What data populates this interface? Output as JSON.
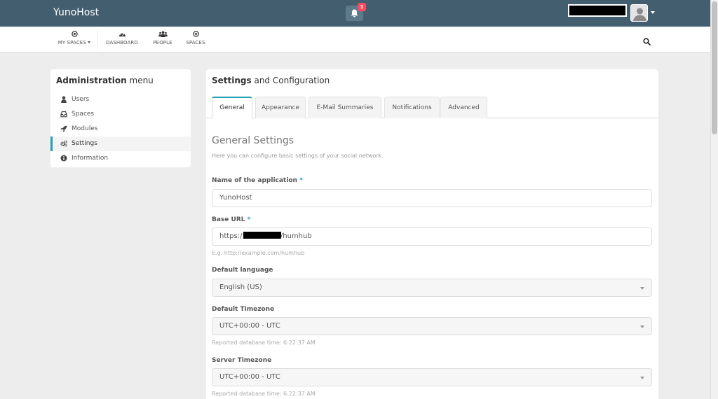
{
  "topbar": {
    "brand": "YunoHost",
    "notification_count": "1",
    "colors": {
      "bar": "#435f6f",
      "accent": "#21a1b3",
      "badge": "#fc4a64"
    }
  },
  "subnav": {
    "items": [
      {
        "label": "MY SPACES",
        "icon": "dot-circle-icon",
        "has_caret": true
      },
      {
        "label": "DASHBOARD",
        "icon": "tachometer-icon"
      },
      {
        "label": "PEOPLE",
        "icon": "users-icon"
      },
      {
        "label": "SPACES",
        "icon": "dot-circle-icon"
      }
    ],
    "search_icon": "search-icon"
  },
  "admin_menu": {
    "title_bold": "Administration",
    "title_rest": " menu",
    "items": [
      {
        "label": "Users",
        "icon": "user-icon"
      },
      {
        "label": "Spaces",
        "icon": "inbox-icon"
      },
      {
        "label": "Modules",
        "icon": "rocket-icon"
      },
      {
        "label": "Settings",
        "icon": "cogs-icon",
        "active": true
      },
      {
        "label": "Information",
        "icon": "info-circle-icon"
      }
    ]
  },
  "settings": {
    "title_bold": "Settings",
    "title_rest": " and Configuration",
    "tabs": [
      "General",
      "Appearance",
      "E-Mail Summaries",
      "Notifications",
      "Advanced"
    ],
    "active_tab": "General",
    "section_title": "General Settings",
    "section_desc": "Here you can configure basic settings of your social network.",
    "fields": {
      "app_name": {
        "label": "Name of the application",
        "required": "*",
        "value": "YunoHost"
      },
      "base_url": {
        "label": "Base URL",
        "required": "*",
        "value_prefix": "https://",
        "value_suffix": "/humhub",
        "hint": "E.g. http://example.com/humhub"
      },
      "default_language": {
        "label": "Default language",
        "value": "English (US)"
      },
      "default_timezone": {
        "label": "Default Timezone",
        "value": "UTC+00:00 - UTC",
        "hint": "Reported database time: 6:22:37 AM"
      },
      "server_timezone": {
        "label": "Server Timezone",
        "value": "UTC+00:00 - UTC",
        "hint": "Reported database time: 6:22:37 AM"
      }
    }
  }
}
